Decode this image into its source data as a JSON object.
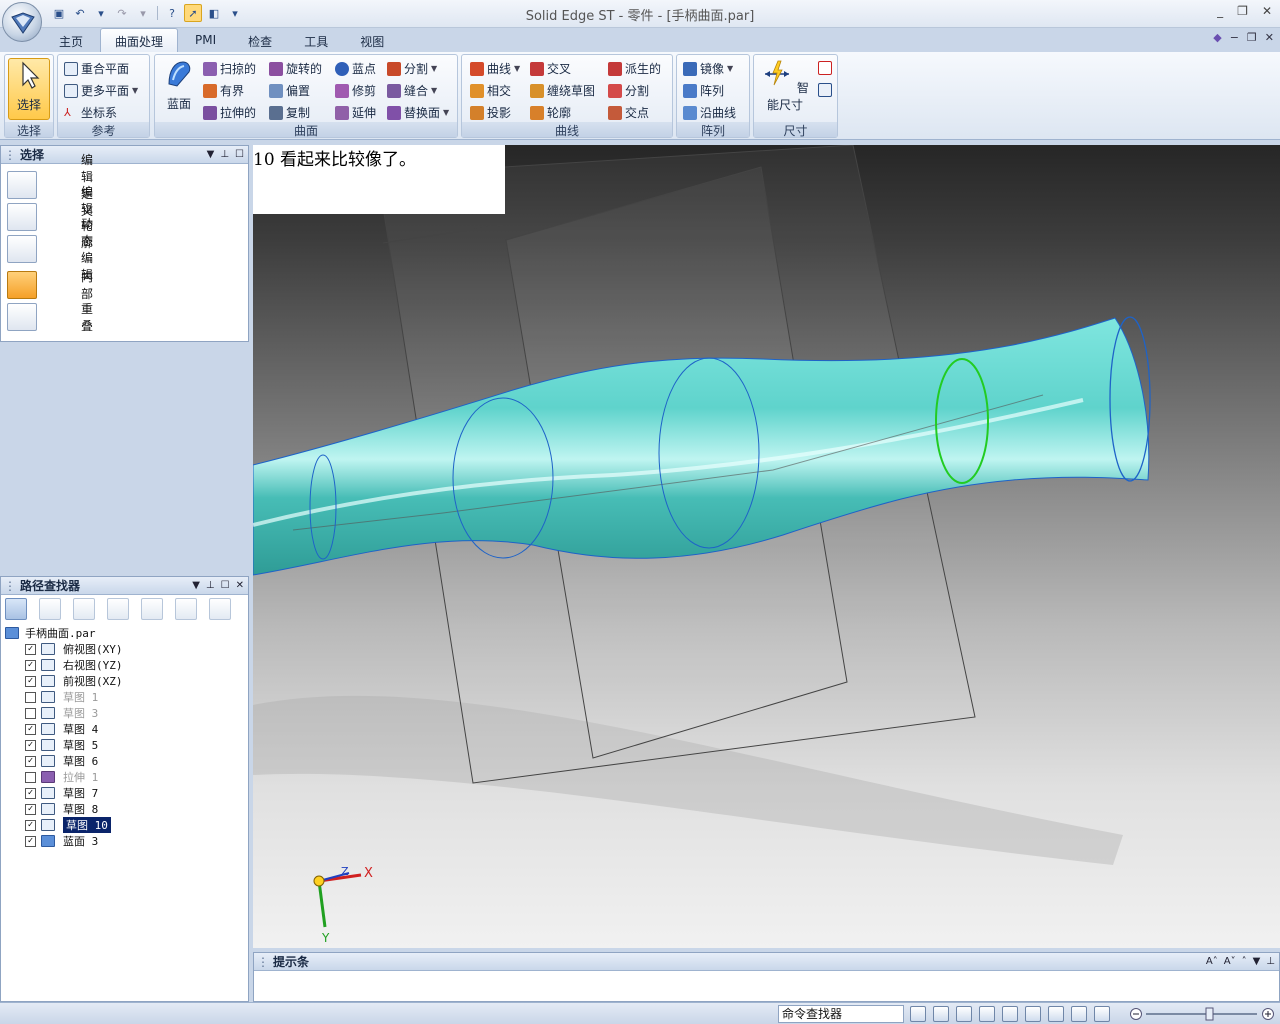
{
  "app": {
    "title": "Solid Edge ST - 零件 - [手柄曲面.par]",
    "window_controls": [
      "_",
      "❐",
      "✕"
    ],
    "doc_controls": [
      "−",
      "❐",
      "✕"
    ]
  },
  "tabs": [
    {
      "label": "主页"
    },
    {
      "label": "曲面处理"
    },
    {
      "label": "PMI"
    },
    {
      "label": "检查"
    },
    {
      "label": "工具"
    },
    {
      "label": "视图"
    }
  ],
  "ribbon": {
    "select": {
      "button": "选择",
      "group": "选择"
    },
    "reference": {
      "items": [
        "重合平面",
        "更多平面",
        "坐标系"
      ],
      "group": "参考"
    },
    "surface": {
      "big": "蓝面",
      "col1": [
        "扫掠的",
        "有界",
        "拉伸的"
      ],
      "col2": [
        "旋转的",
        "偏置",
        "复制"
      ],
      "col3": [
        "蓝点",
        "修剪",
        "延伸"
      ],
      "col4": [
        "分割",
        "缝合",
        "替换面"
      ],
      "group": "曲面"
    },
    "curves": {
      "col1": [
        "曲线",
        "相交",
        "投影"
      ],
      "col2": [
        "交叉",
        "缠绕草图",
        "轮廓"
      ],
      "col3": [
        "派生的",
        "分割",
        "交点"
      ],
      "group": "曲线"
    },
    "pattern": {
      "items": [
        "镜像",
        "阵列",
        "沿曲线"
      ],
      "group": "阵列"
    },
    "dimension": {
      "big": "智能尺寸",
      "group": "尺寸"
    }
  },
  "select_pane": {
    "title": "选择",
    "items": [
      {
        "label": "编辑定义",
        "icon": "edit-definition-icon"
      },
      {
        "label": "编辑轮廓",
        "icon": "edit-profile-icon"
      },
      {
        "label": "动态编辑",
        "icon": "dynamic-edit-icon"
      },
      {
        "label": "内部",
        "icon": "inside-icon"
      },
      {
        "label": "重叠",
        "icon": "overlap-icon"
      }
    ]
  },
  "pathfinder": {
    "title": "路径查找器",
    "root": "手柄曲面.par",
    "nodes": [
      {
        "label": "俯视图(XY)",
        "checked": true,
        "type": "plane"
      },
      {
        "label": "右视图(YZ)",
        "checked": true,
        "type": "plane"
      },
      {
        "label": "前视图(XZ)",
        "checked": true,
        "type": "plane"
      },
      {
        "label": "草图 1",
        "checked": false,
        "type": "sketch"
      },
      {
        "label": "草图 3",
        "checked": false,
        "type": "sketch"
      },
      {
        "label": "草图 4",
        "checked": true,
        "type": "sketch"
      },
      {
        "label": "草图 5",
        "checked": true,
        "type": "sketch"
      },
      {
        "label": "草图 6",
        "checked": true,
        "type": "sketch"
      },
      {
        "label": "拉伸 1",
        "checked": false,
        "type": "extrude"
      },
      {
        "label": "草图 7",
        "checked": true,
        "type": "sketch"
      },
      {
        "label": "草图 8",
        "checked": true,
        "type": "sketch"
      },
      {
        "label": "草图 10",
        "checked": true,
        "type": "sketch",
        "selected": true
      },
      {
        "label": "蓝面 3",
        "checked": true,
        "type": "bluesurf"
      }
    ]
  },
  "viewport": {
    "note": "10 看起来比较像了。",
    "axes": {
      "x": "X",
      "y": "Y",
      "z": "Z"
    },
    "surface_color": "#5fd3cc",
    "highlight_color": "#22cc22"
  },
  "prompt": {
    "title": "提示条"
  },
  "statusbar": {
    "command_finder": "命令查找器"
  }
}
